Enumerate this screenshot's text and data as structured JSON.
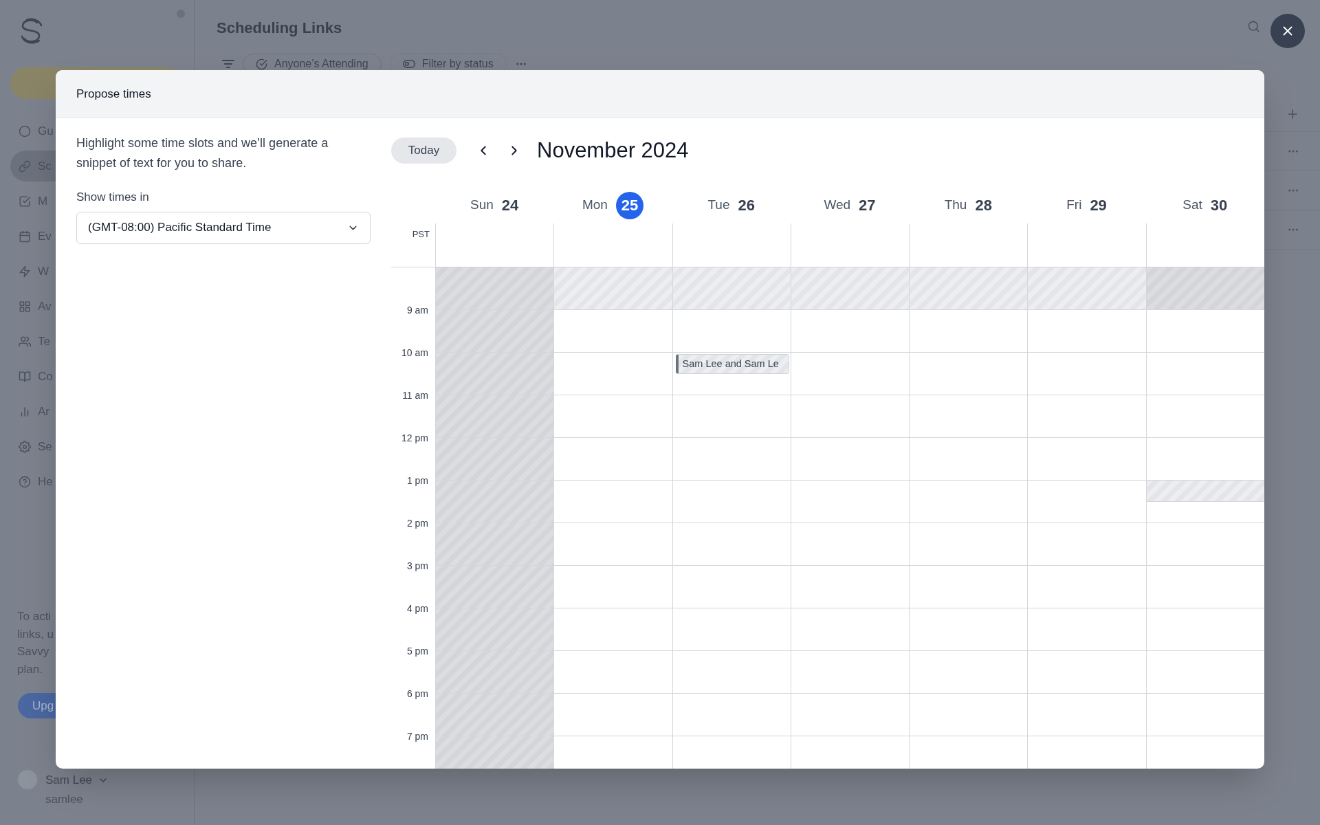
{
  "sidebar": {
    "items": [
      {
        "label": "Gu",
        "selected": false
      },
      {
        "label": "Sc",
        "selected": true
      },
      {
        "label": "M",
        "selected": false
      },
      {
        "label": "Ev",
        "selected": false
      },
      {
        "label": "W",
        "selected": false
      },
      {
        "label": "Av",
        "selected": false
      },
      {
        "label": "Te",
        "selected": false
      },
      {
        "label": "Co",
        "selected": false
      },
      {
        "label": "Ar",
        "selected": false
      },
      {
        "label": "Se",
        "selected": false
      },
      {
        "label": "He",
        "selected": false
      }
    ],
    "upgrade_note": [
      "To acti",
      "links, u",
      "Savvy",
      "plan."
    ],
    "upgrade_button": "Upg",
    "user": {
      "name": "Sam Lee",
      "handle": "samlee"
    }
  },
  "page": {
    "title": "Scheduling Links",
    "filters": [
      "Anyone’s Attending",
      "Filter by status"
    ]
  },
  "modal": {
    "title": "Propose times",
    "description": "Highlight some time slots and we’ll generate a snippet of text for you to share.",
    "timezone_label": "Show times in",
    "timezone": "(GMT-08:00) Pacific Standard Time",
    "today_button": "Today",
    "month": "November 2024",
    "timezone_short": "PST",
    "hours": [
      "9 am",
      "10 am",
      "11 am",
      "12 pm",
      "1 pm",
      "2 pm",
      "3 pm",
      "4 pm",
      "5 pm",
      "6 pm",
      "7 pm"
    ],
    "days": [
      {
        "weekday": "Sun",
        "date": "24",
        "selected": false,
        "slots": [
          {
            "kind": "off"
          },
          {
            "kind": "off"
          },
          {
            "kind": "off"
          },
          {
            "kind": "off"
          },
          {
            "kind": "off"
          },
          {
            "kind": "off"
          },
          {
            "kind": "off"
          },
          {
            "kind": "off"
          },
          {
            "kind": "off"
          },
          {
            "kind": "off"
          },
          {
            "kind": "off"
          },
          {
            "kind": "off"
          }
        ]
      },
      {
        "weekday": "Mon",
        "date": "25",
        "selected": true,
        "slots": [
          {
            "kind": "blocked"
          },
          {
            "kind": "open"
          },
          {
            "kind": "open"
          },
          {
            "kind": "open"
          },
          {
            "kind": "open"
          },
          {
            "kind": "open"
          },
          {
            "kind": "open"
          },
          {
            "kind": "open"
          },
          {
            "kind": "open"
          },
          {
            "kind": "open"
          },
          {
            "kind": "open"
          },
          {
            "kind": "open"
          }
        ]
      },
      {
        "weekday": "Tue",
        "date": "26",
        "selected": false,
        "slots": [
          {
            "kind": "blocked"
          },
          {
            "kind": "open"
          },
          {
            "kind": "open",
            "event": "Sam Lee and Sam Le"
          },
          {
            "kind": "open"
          },
          {
            "kind": "open"
          },
          {
            "kind": "open"
          },
          {
            "kind": "open"
          },
          {
            "kind": "open"
          },
          {
            "kind": "open"
          },
          {
            "kind": "open"
          },
          {
            "kind": "open"
          },
          {
            "kind": "open"
          }
        ]
      },
      {
        "weekday": "Wed",
        "date": "27",
        "selected": false,
        "slots": [
          {
            "kind": "blocked"
          },
          {
            "kind": "open"
          },
          {
            "kind": "open"
          },
          {
            "kind": "open"
          },
          {
            "kind": "open"
          },
          {
            "kind": "open"
          },
          {
            "kind": "open"
          },
          {
            "kind": "open"
          },
          {
            "kind": "open"
          },
          {
            "kind": "open"
          },
          {
            "kind": "open"
          },
          {
            "kind": "open"
          }
        ]
      },
      {
        "weekday": "Thu",
        "date": "28",
        "selected": false,
        "slots": [
          {
            "kind": "blocked"
          },
          {
            "kind": "open"
          },
          {
            "kind": "open"
          },
          {
            "kind": "open"
          },
          {
            "kind": "open"
          },
          {
            "kind": "open"
          },
          {
            "kind": "open"
          },
          {
            "kind": "open"
          },
          {
            "kind": "open"
          },
          {
            "kind": "open"
          },
          {
            "kind": "open"
          },
          {
            "kind": "open"
          }
        ]
      },
      {
        "weekday": "Fri",
        "date": "29",
        "selected": false,
        "slots": [
          {
            "kind": "blocked"
          },
          {
            "kind": "open"
          },
          {
            "kind": "open"
          },
          {
            "kind": "open"
          },
          {
            "kind": "open"
          },
          {
            "kind": "open"
          },
          {
            "kind": "open"
          },
          {
            "kind": "open"
          },
          {
            "kind": "open"
          },
          {
            "kind": "open"
          },
          {
            "kind": "open"
          },
          {
            "kind": "open"
          }
        ]
      },
      {
        "weekday": "Sat",
        "date": "30",
        "selected": false,
        "slots": [
          {
            "kind": "off"
          },
          {
            "kind": "open"
          },
          {
            "kind": "open"
          },
          {
            "kind": "open"
          },
          {
            "kind": "open"
          },
          {
            "kind": "blocked-half"
          },
          {
            "kind": "open"
          },
          {
            "kind": "open"
          },
          {
            "kind": "open"
          },
          {
            "kind": "open"
          },
          {
            "kind": "open"
          },
          {
            "kind": "open"
          }
        ]
      }
    ]
  }
}
